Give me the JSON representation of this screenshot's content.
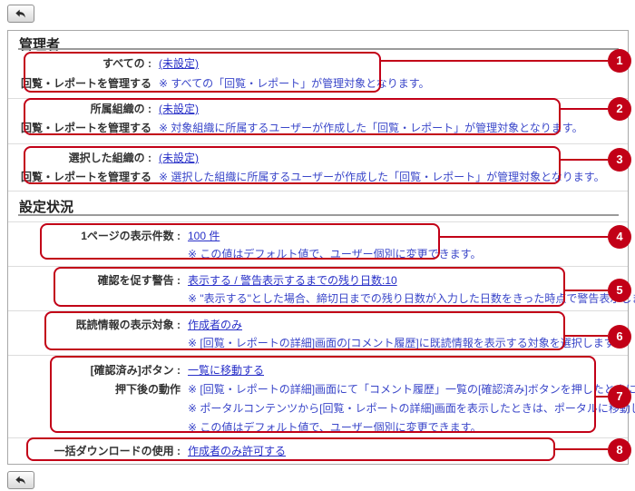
{
  "icons": {
    "back_button": "undo-arrow"
  },
  "callout_color": "#c20017",
  "callouts": [
    "1",
    "2",
    "3",
    "4",
    "5",
    "6",
    "7",
    "8"
  ],
  "sections": [
    {
      "heading": "管理者",
      "rows": [
        {
          "label1": "すべての :",
          "label2": "回覧・レポートを管理する",
          "link": "(未設定)",
          "notes": [
            "※ すべての「回覧・レポート」が管理対象となります。"
          ]
        },
        {
          "label1": "所属組織の :",
          "label2": "回覧・レポートを管理する",
          "link": "(未設定)",
          "notes": [
            "※ 対象組織に所属するユーザーが作成した「回覧・レポート」が管理対象となります。"
          ]
        },
        {
          "label1": "選択した組織の :",
          "label2": "回覧・レポートを管理する",
          "link": "(未設定)",
          "notes": [
            "※ 選択した組織に所属するユーザーが作成した「回覧・レポート」が管理対象となります。"
          ]
        }
      ]
    },
    {
      "heading": "設定状況",
      "rows": [
        {
          "label1": "1ページの表示件数 :",
          "link": "100 件",
          "notes": [
            "※ この値はデフォルト値で、ユーザー個別に変更できます。"
          ]
        },
        {
          "label1": "確認を促す警告 :",
          "link": "表示する / 警告表示するまでの残り日数:10",
          "notes": [
            "※ \"表示する\"とした場合、締切日までの残り日数が入力した日数をきった時点で警告表示します。"
          ]
        },
        {
          "label1": "既読情報の表示対象 :",
          "link": "作成者のみ",
          "notes": [
            "※ [回覧・レポートの詳細]画面の[コメント履歴]に既読情報を表示する対象を選択します。"
          ]
        },
        {
          "label1": "[確認済み]ボタン :",
          "label2": "押下後の動作",
          "link": "一覧に移動する",
          "notes": [
            "※ [回覧・レポートの詳細]画面にて「コメント履歴」一覧の[確認済み]ボタンを押したときに適用されます。",
            "※ ポータルコンテンツから[回覧・レポートの詳細]画面を表示したときは、ポータルに移動します。",
            "※ この値はデフォルト値で、ユーザー個別に変更できます。"
          ]
        },
        {
          "label1": "一括ダウンロードの使用 :",
          "link": "作成者のみ許可する",
          "notes": []
        }
      ]
    }
  ]
}
